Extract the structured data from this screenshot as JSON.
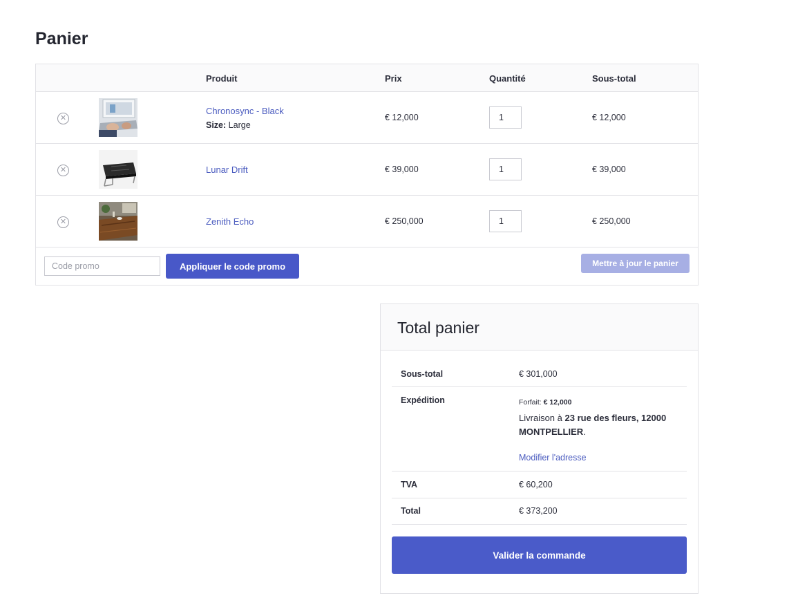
{
  "page": {
    "title": "Panier"
  },
  "cart": {
    "headers": {
      "product": "Produit",
      "price": "Prix",
      "quantity": "Quantité",
      "subtotal": "Sous-total"
    },
    "items": [
      {
        "name": "Chronosync - Black",
        "meta_label": "Size:",
        "meta_value": "Large",
        "price": "€ 12,000",
        "quantity": "1",
        "subtotal": "€ 12,000",
        "remove_icon": "circle-x-icon",
        "image": "laptop-typing-photo"
      },
      {
        "name": "Lunar Drift",
        "price": "€ 39,000",
        "quantity": "1",
        "subtotal": "€ 39,000",
        "remove_icon": "circle-x-icon",
        "image": "black-leather-bench-photo"
      },
      {
        "name": "Zenith Echo",
        "price": "€ 250,000",
        "quantity": "1",
        "subtotal": "€ 250,000",
        "remove_icon": "circle-x-icon",
        "image": "wooden-table-photo"
      }
    ],
    "promo": {
      "placeholder": "Code promo",
      "value": "",
      "apply_label": "Appliquer le code promo"
    },
    "update_label": "Mettre à jour le panier"
  },
  "totals": {
    "title": "Total panier",
    "subtotal_label": "Sous-total",
    "subtotal_value": "€ 301,000",
    "shipping_label": "Expédition",
    "shipping_method_label": "Forfait:",
    "shipping_method_value": "€ 12,000",
    "shipping_address_prefix": "Livraison à",
    "shipping_address": "23 rue des fleurs, 12000 MONTPELLIER",
    "shipping_address_suffix": ".",
    "change_address_label": "Modifier l'adresse",
    "tax_label": "TVA",
    "tax_value": "€ 60,200",
    "total_label": "Total",
    "total_value": "€ 373,200",
    "checkout_label": "Valider la commande"
  },
  "colors": {
    "accent": "#4858c8",
    "accent_disabled": "#a7afe4",
    "link": "#4a5bbf",
    "border": "#e2e2e6"
  }
}
